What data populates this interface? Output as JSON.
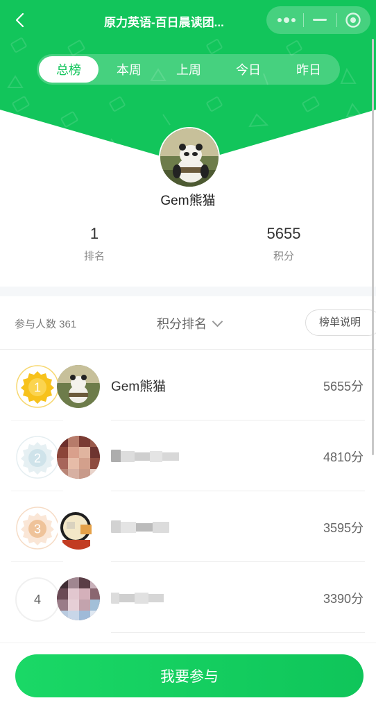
{
  "nav": {
    "title": "原力英语-百日晨读团...",
    "back_icon": "chevron-left-icon",
    "more_icon": "more-dots-icon",
    "minimize_icon": "minimize-icon",
    "close_icon": "target-circle-icon"
  },
  "tabs": [
    {
      "label": "总榜",
      "active": true
    },
    {
      "label": "本周",
      "active": false
    },
    {
      "label": "上周",
      "active": false
    },
    {
      "label": "今日",
      "active": false
    },
    {
      "label": "昨日",
      "active": false
    }
  ],
  "me": {
    "name": "Gem熊猫",
    "rank_value": "1",
    "rank_label": "排名",
    "score_value": "5655",
    "score_label": "积分"
  },
  "filter": {
    "participants": "参与人数 361",
    "sort_label": "积分排名",
    "explain_label": "榜单说明"
  },
  "rows": [
    {
      "rank": "1",
      "name": "Gem熊猫",
      "score": "5655分",
      "medal": "gold"
    },
    {
      "rank": "2",
      "name": "",
      "score": "4810分",
      "medal": "silver"
    },
    {
      "rank": "3",
      "name": "",
      "score": "3595分",
      "medal": "bronze"
    },
    {
      "rank": "4",
      "name": "",
      "score": "3390分",
      "medal": "none"
    }
  ],
  "cta": {
    "label": "我要参与"
  },
  "colors": {
    "brand_green": "#10c45a",
    "gold": "#f7c21c",
    "silver": "#cfe3ea",
    "bronze": "#efc39a"
  }
}
